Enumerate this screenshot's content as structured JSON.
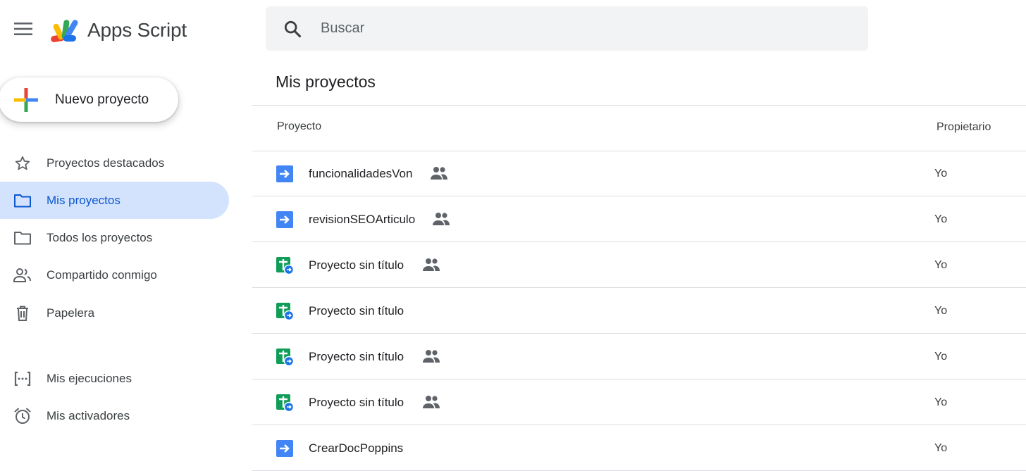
{
  "app": {
    "title": "Apps Script"
  },
  "search": {
    "placeholder": "Buscar"
  },
  "new_project": {
    "label": "Nuevo proyecto"
  },
  "sidebar": {
    "items": [
      {
        "label": "Proyectos destacados",
        "icon": "star-icon"
      },
      {
        "label": "Mis proyectos",
        "icon": "folder-icon",
        "active": true
      },
      {
        "label": "Todos los proyectos",
        "icon": "folder-icon"
      },
      {
        "label": "Compartido conmigo",
        "icon": "people-icon"
      },
      {
        "label": "Papelera",
        "icon": "trash-icon"
      },
      {
        "label": "Mis ejecuciones",
        "icon": "executions-icon"
      },
      {
        "label": "Mis activadores",
        "icon": "alarm-icon"
      }
    ]
  },
  "main": {
    "title": "Mis proyectos",
    "columns": {
      "project": "Proyecto",
      "owner": "Propietario"
    },
    "rows": [
      {
        "name": "funcionalidadesVon",
        "type": "standalone-script-icon",
        "shared": true,
        "owner": "Yo"
      },
      {
        "name": "revisionSEOArticulo",
        "type": "standalone-script-icon",
        "shared": true,
        "owner": "Yo"
      },
      {
        "name": "Proyecto sin título",
        "type": "sheets-script-icon",
        "shared": true,
        "owner": "Yo"
      },
      {
        "name": "Proyecto sin título",
        "type": "sheets-script-icon",
        "shared": false,
        "owner": "Yo"
      },
      {
        "name": "Proyecto sin título",
        "type": "sheets-script-icon",
        "shared": true,
        "owner": "Yo"
      },
      {
        "name": "Proyecto sin título",
        "type": "sheets-script-icon",
        "shared": true,
        "owner": "Yo"
      },
      {
        "name": "CrearDocPoppins",
        "type": "standalone-script-icon",
        "shared": false,
        "owner": "Yo"
      }
    ]
  },
  "colors": {
    "active_nav_bg": "#d3e3fd",
    "active_nav_text": "#0b57d0",
    "script_blue": "#4285f4",
    "sheets_green": "#0f9d58"
  }
}
